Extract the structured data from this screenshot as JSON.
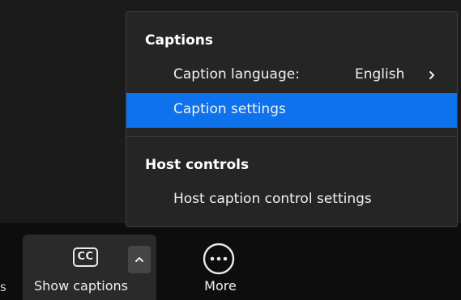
{
  "menu": {
    "captions_heading": "Captions",
    "caption_language_label": "Caption language:",
    "caption_language_value": "English",
    "caption_settings_label": "Caption settings",
    "host_controls_heading": "Host controls",
    "host_caption_control_label": "Host caption control settings"
  },
  "toolbar": {
    "cut_text": "s",
    "cc_icon_text": "CC",
    "show_captions_label": "Show captions",
    "more_label": "More"
  },
  "colors": {
    "selected_item": "#0e72ed",
    "menu_background": "#252525",
    "toolbar_background": "#0d0d0d"
  },
  "icons": {
    "submenu_arrow": "chevron-right-icon",
    "options_caret": "chevron-up-icon",
    "more": "more-options-icon"
  }
}
